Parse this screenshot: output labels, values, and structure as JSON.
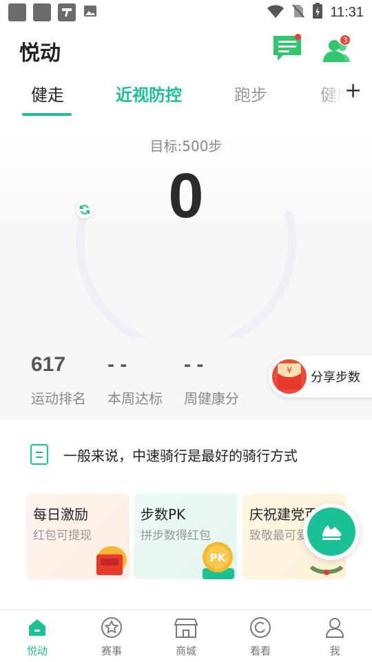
{
  "status_bar": {
    "time": "11:31",
    "icons": [
      "app-icon",
      "app-icon",
      "flipboard-icon",
      "image-icon",
      "wifi-icon",
      "no-sim-icon",
      "battery-icon"
    ]
  },
  "header": {
    "title": "悦动",
    "friends_badge": "3"
  },
  "tabs": [
    {
      "label": "健走",
      "state": "active"
    },
    {
      "label": "近视防控",
      "state": "highlight"
    },
    {
      "label": "跑步",
      "state": "normal"
    },
    {
      "label": "健康",
      "state": "normal"
    }
  ],
  "tracker": {
    "goal": "目标:500步",
    "steps": "0",
    "progress": 0
  },
  "stats": [
    {
      "value": "617",
      "label": "运动排名"
    },
    {
      "value": "- -",
      "label": "本周达标"
    },
    {
      "value": "- -",
      "label": "周健康分"
    }
  ],
  "share": {
    "label": "分享步数"
  },
  "tip": {
    "text": "一般来说，中速骑行是最好的骑行方式"
  },
  "promos": [
    {
      "title": "每日激励",
      "subtitle": "红包可提现"
    },
    {
      "title": "步数PK",
      "subtitle": "拼步数得红包",
      "badge": "PK"
    },
    {
      "title": "庆祝建党百年",
      "subtitle": "致敬最可爱的人"
    }
  ],
  "bottom_nav": [
    {
      "label": "悦动",
      "icon": "home-icon",
      "active": true
    },
    {
      "label": "赛事",
      "icon": "star-icon",
      "active": false
    },
    {
      "label": "商城",
      "icon": "store-icon",
      "active": false
    },
    {
      "label": "看看",
      "icon": "watch-icon",
      "active": false
    },
    {
      "label": "我",
      "icon": "user-icon",
      "active": false
    }
  ],
  "colors": {
    "accent": "#19c195",
    "badge": "#f44336",
    "text_dark": "#222222",
    "text_muted": "#888888"
  }
}
